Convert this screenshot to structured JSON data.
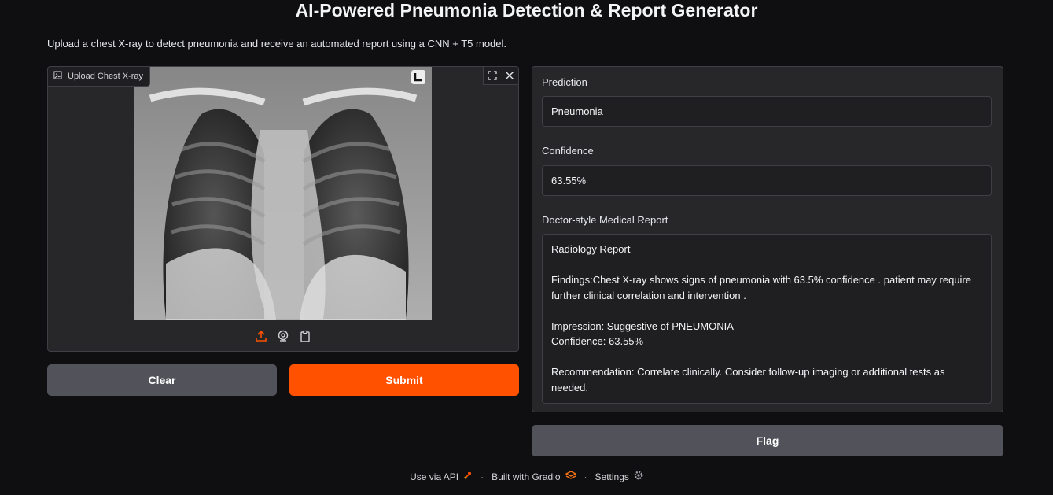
{
  "header": {
    "title": "AI-Powered Pneumonia Detection & Report Generator",
    "description": "Upload a chest X-ray to detect pneumonia and receive an automated report using a CNN + T5 model."
  },
  "image_input": {
    "label": "Upload Chest X-ray",
    "icon": "image-icon",
    "controls": [
      "fullscreen-icon",
      "close-icon"
    ],
    "sources": [
      "upload-icon",
      "webcam-icon",
      "clipboard-icon"
    ]
  },
  "buttons": {
    "clear": "Clear",
    "submit": "Submit",
    "flag": "Flag"
  },
  "outputs": {
    "prediction_label": "Prediction",
    "prediction_value": "Pneumonia",
    "confidence_label": "Confidence",
    "confidence_value": "63.55%",
    "report_label": "Doctor-style Medical Report",
    "report_text": "Radiology Report\n\nFindings:Chest X-ray shows signs of pneumonia with 63.5% confidence . patient may require further clinical correlation and intervention .\n\nImpression: Suggestive of PNEUMONIA\nConfidence: 63.55%\n\nRecommendation: Correlate clinically. Consider follow-up imaging or additional tests as needed."
  },
  "footer": {
    "api": "Use via API",
    "built": "Built with Gradio",
    "settings": "Settings"
  },
  "colors": {
    "accent": "#ff5100",
    "background": "#0f0f11",
    "panel": "#27272a",
    "secondary_button": "#52525b"
  }
}
